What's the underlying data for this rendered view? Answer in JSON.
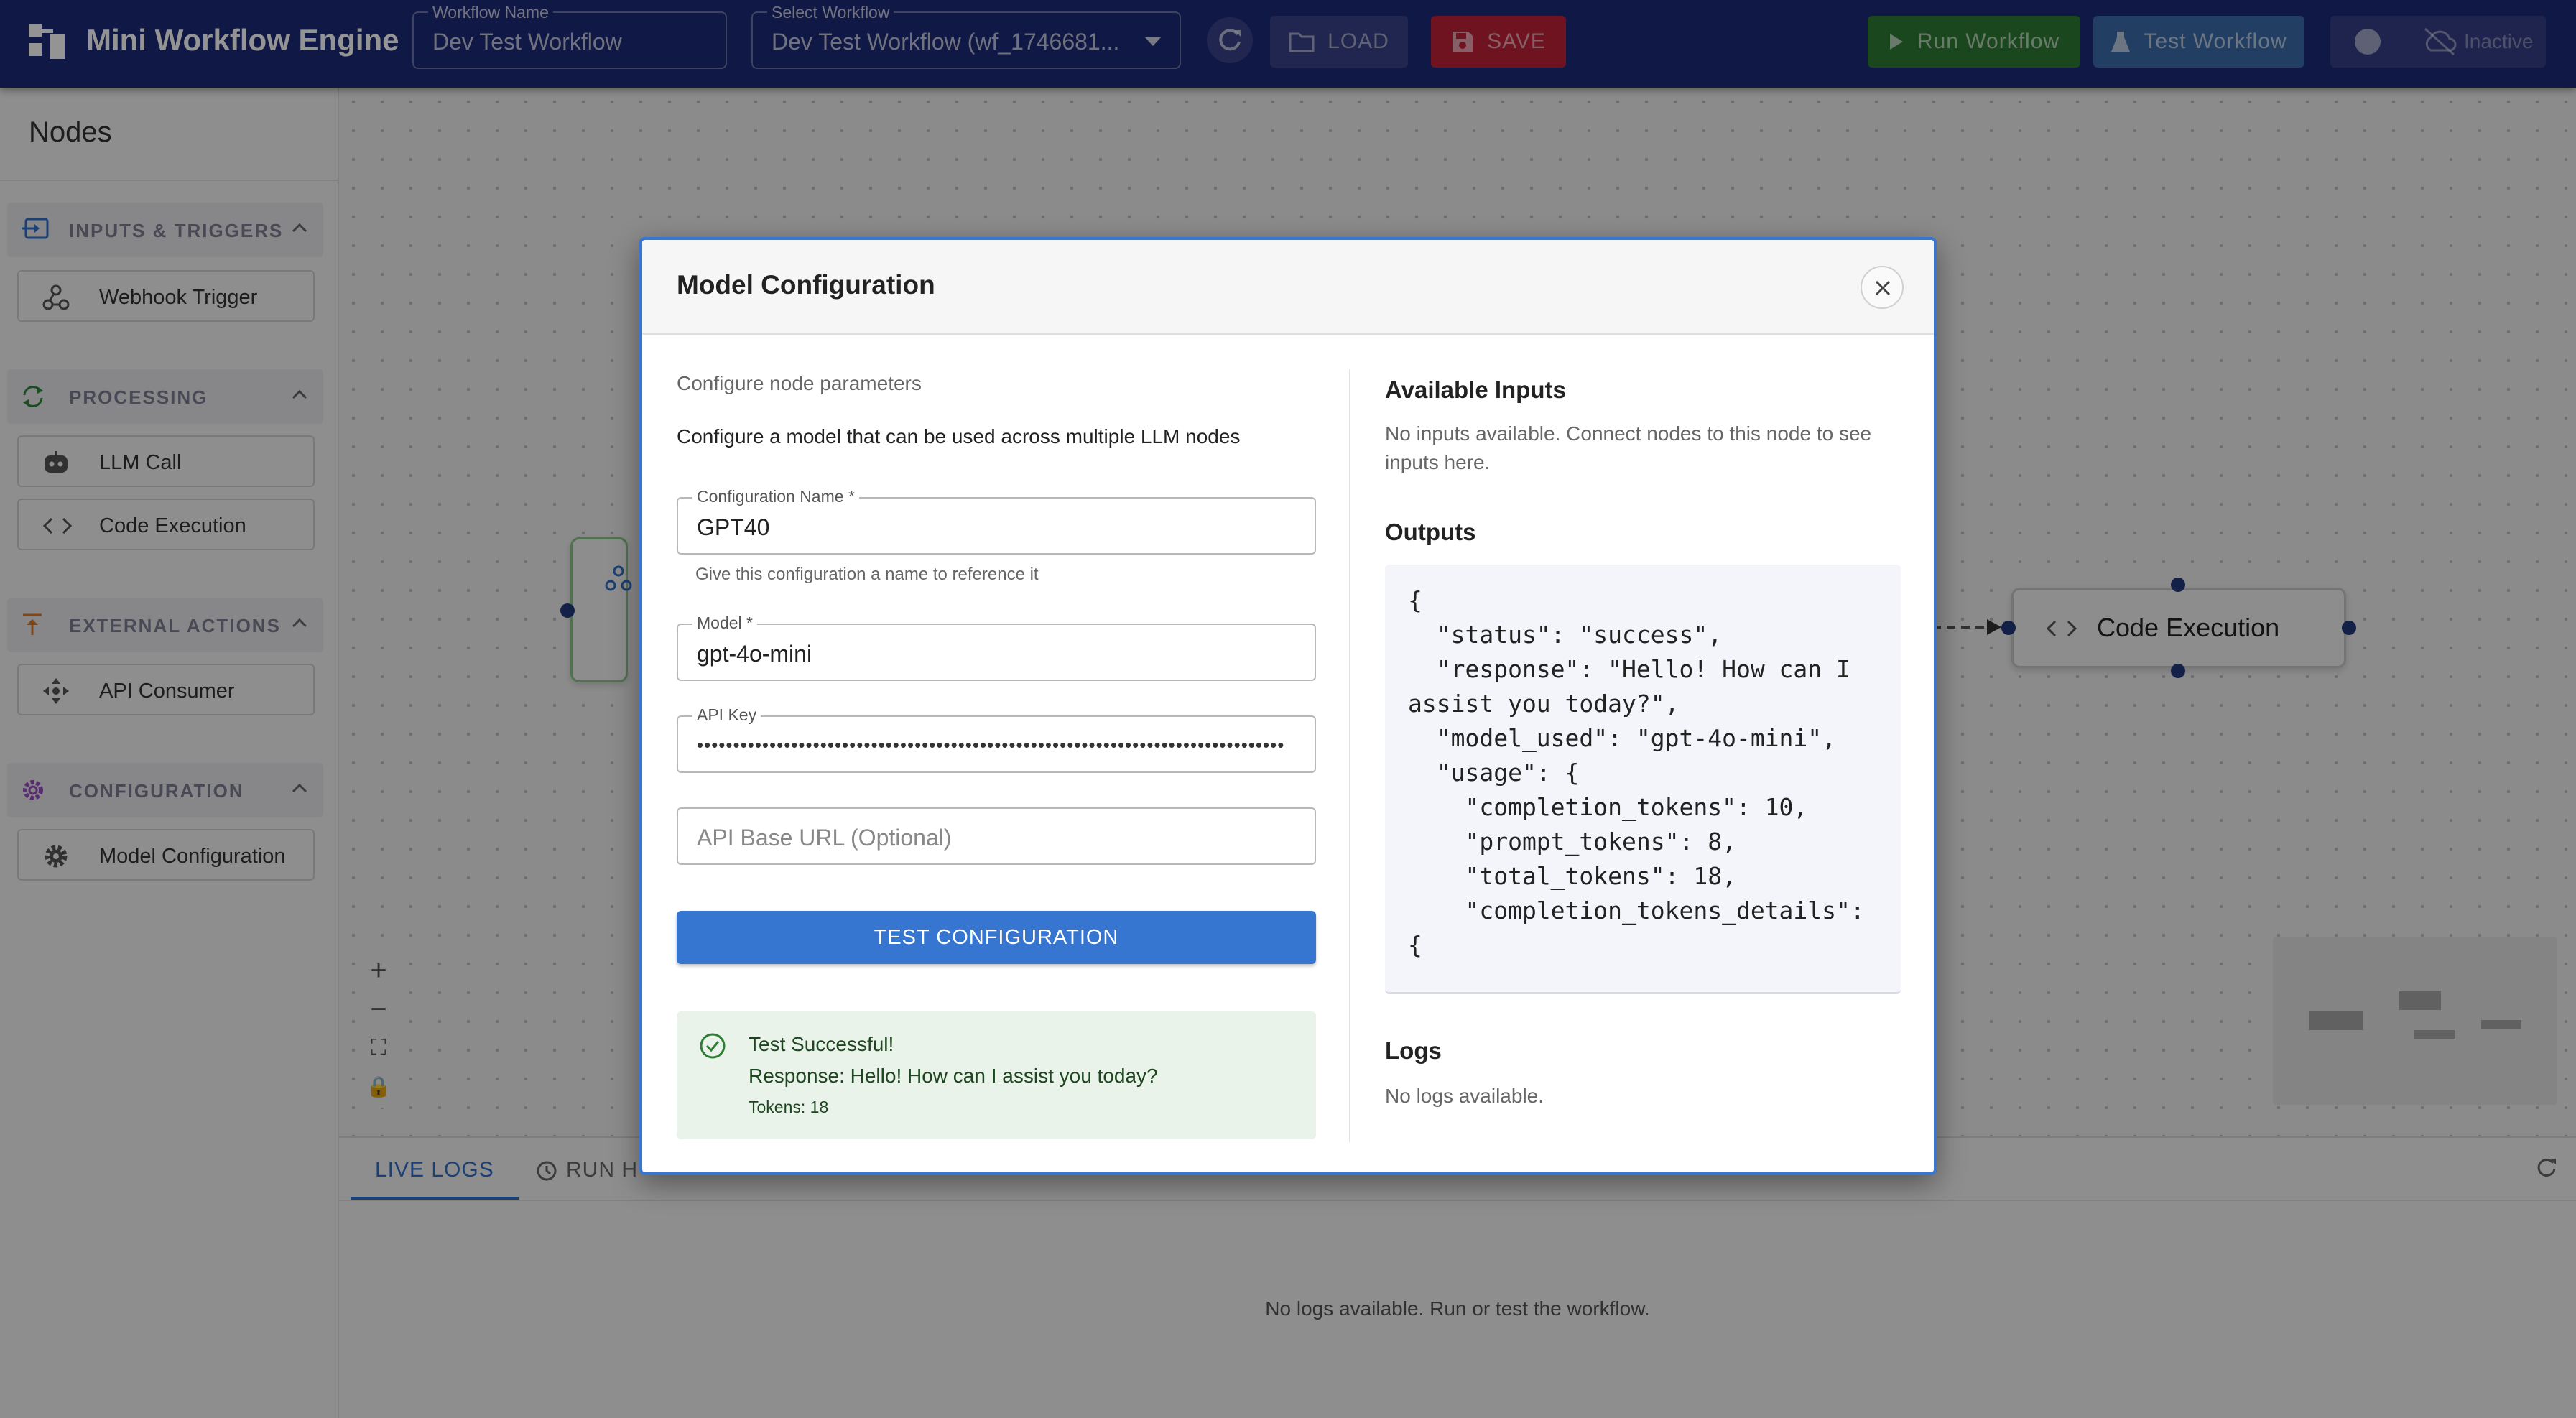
{
  "header": {
    "app_title": "Mini Workflow Engine",
    "workflow_name": {
      "label": "Workflow Name",
      "value": "Dev Test Workflow"
    },
    "select_workflow": {
      "label": "Select Workflow",
      "value": "Dev Test Workflow (wf_1746681..."
    },
    "load_label": "LOAD",
    "save_label": "SAVE",
    "run_label": "Run Workflow",
    "test_label": "Test Workflow",
    "status_label": "Inactive"
  },
  "sidebar": {
    "title": "Nodes",
    "categories": [
      {
        "label": "INPUTS & TRIGGERS",
        "items": [
          "Webhook Trigger"
        ]
      },
      {
        "label": "PROCESSING",
        "items": [
          "LLM Call",
          "Code Execution"
        ]
      },
      {
        "label": "EXTERNAL ACTIONS",
        "items": [
          "API Consumer"
        ]
      },
      {
        "label": "CONFIGURATION",
        "items": [
          "Model Configuration"
        ]
      }
    ]
  },
  "canvas": {
    "code_node_label": "Code Execution"
  },
  "bottom_panel": {
    "tabs": [
      "LIVE LOGS",
      "RUN H"
    ],
    "empty_text": "No logs available. Run or test the workflow."
  },
  "dialog": {
    "title": "Model Configuration",
    "subtitle": "Configure node parameters",
    "description": "Configure a model that can be used across multiple LLM nodes",
    "config_name": {
      "label": "Configuration Name *",
      "value": "GPT40",
      "helper": "Give this configuration a name to reference it"
    },
    "model": {
      "label": "Model *",
      "value": "gpt-4o-mini"
    },
    "api_key": {
      "label": "API Key",
      "value": "•••••••••••••••••••••••••••••••••••••••••••••••••••••••••••••••••••••••••••••••••"
    },
    "api_base_url": {
      "placeholder": "API Base URL (Optional)"
    },
    "test_button_label": "TEST CONFIGURATION",
    "test_result": {
      "title": "Test Successful!",
      "response": "Response: Hello! How can I assist you today?",
      "tokens": "Tokens: 18"
    },
    "inputs": {
      "title": "Available Inputs",
      "text": "No inputs available. Connect nodes to this node to see inputs here."
    },
    "outputs": {
      "title": "Outputs",
      "code": "{\n  \"status\": \"success\",\n  \"response\": \"Hello! How can I\nassist you today?\",\n  \"model_used\": \"gpt-4o-mini\",\n  \"usage\": {\n    \"completion_tokens\": 10,\n    \"prompt_tokens\": 8,\n    \"total_tokens\": 18,\n    \"completion_tokens_details\":\n{"
    },
    "logs": {
      "title": "Logs",
      "text": "No logs available."
    }
  },
  "colors": {
    "header_bg": "#1d2a78",
    "accent_blue": "#3676d0",
    "save_red": "#c2223a",
    "run_green": "#2d7a32",
    "success_bg": "#eaf3ea"
  },
  "icons": [
    "workflow-logo-icon",
    "refresh-icon",
    "folder-icon",
    "save-icon",
    "play-icon",
    "flask-icon",
    "cloud-off-icon",
    "webhook-icon",
    "robot-icon",
    "code-icon",
    "move-icon",
    "gear-icon",
    "close-icon",
    "check-circle-icon",
    "history-icon"
  ]
}
